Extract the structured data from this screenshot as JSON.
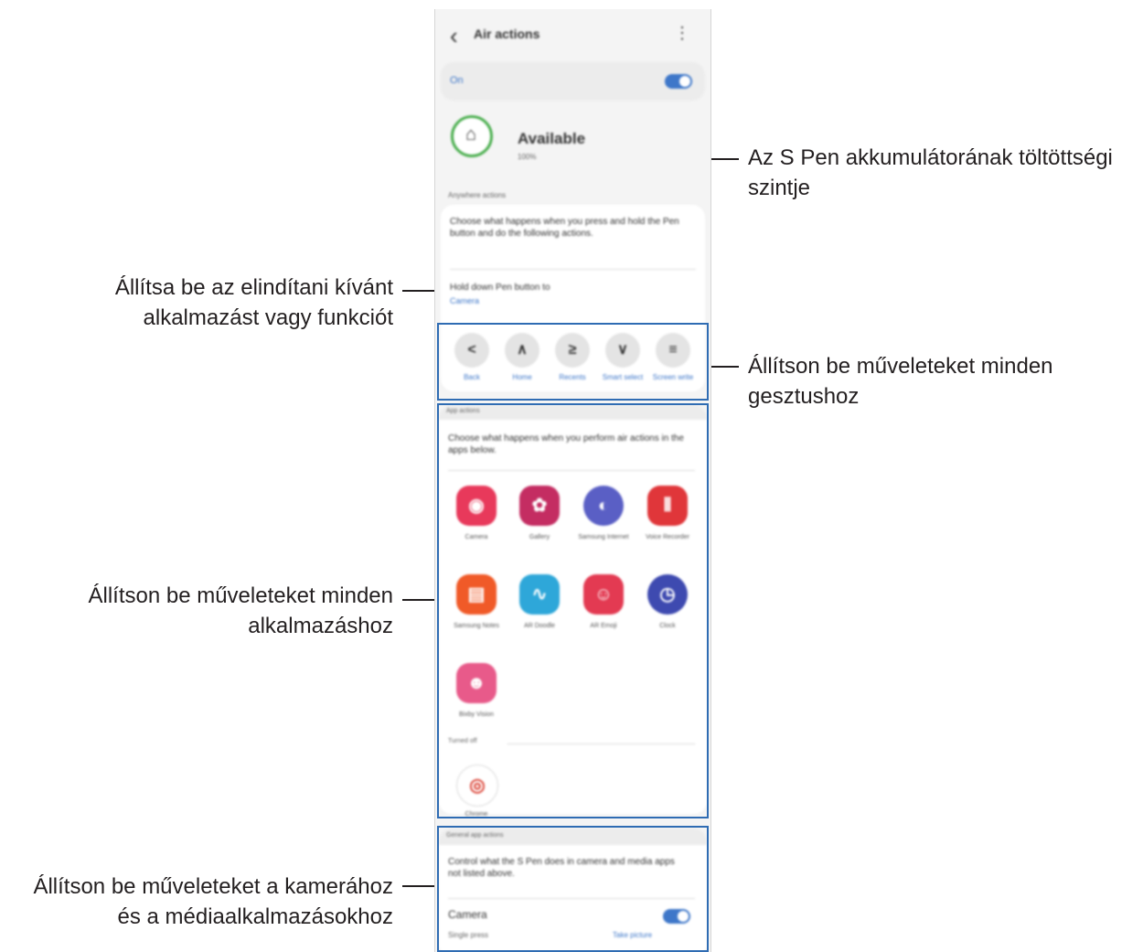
{
  "callouts": {
    "battery": "Az S Pen akkumulátorának töltöttségi szintje",
    "launch_app": "Állítsa be az elindítani kívánt alkalmazást vagy funkciót",
    "gestures": "Állítson be műveleteket minden gesztushoz",
    "apps": "Állítson be műveleteket minden alkalmazáshoz",
    "camera_media": "Állítson be műveleteket a kamerához és a médiaalkalmazásokhoz"
  },
  "phone": {
    "title": "Air actions",
    "master_toggle": {
      "label": "On",
      "state": "on"
    },
    "status": {
      "label": "Available",
      "battery_text": "100%"
    },
    "anywhere": {
      "header": "Anywhere actions",
      "description": "Choose what happens when you press and hold the Pen button and do the following actions.",
      "hold_label": "Hold down Pen button to",
      "hold_value": "Camera",
      "gestures": [
        {
          "glyph": "<",
          "label": "Back"
        },
        {
          "glyph": "∧",
          "label": "Home"
        },
        {
          "glyph": "≥",
          "label": "Recents"
        },
        {
          "glyph": "∨",
          "label": "Smart select"
        },
        {
          "glyph": "≡",
          "label": "Screen write"
        }
      ]
    },
    "app_actions": {
      "header": "App actions",
      "description": "Choose what happens when you perform air actions in the apps below.",
      "apps": [
        {
          "name": "Camera",
          "color": "#e8395b",
          "glyph": "◉"
        },
        {
          "name": "Gallery",
          "color": "#c42d62",
          "glyph": "✿"
        },
        {
          "name": "Samsung Internet",
          "color": "#5a5fc5",
          "glyph": "◐"
        },
        {
          "name": "Voice Recorder",
          "color": "#e0363a",
          "glyph": "⦀"
        },
        {
          "name": "Samsung Notes",
          "color": "#f05a28",
          "glyph": "▤"
        },
        {
          "name": "AR Doodle",
          "color": "#2ea7d9",
          "glyph": "∿"
        },
        {
          "name": "AR Emoji",
          "color": "#e33a52",
          "glyph": "☺"
        },
        {
          "name": "Clock",
          "color": "#3e4ab0",
          "glyph": "◷"
        },
        {
          "name": "Bixby Vision",
          "color": "#e85a8a",
          "glyph": "☻"
        }
      ],
      "turned_off_label": "Turned off",
      "turned_off_apps": [
        {
          "name": "Chrome",
          "color": "#ffffff",
          "glyph": "◎"
        }
      ]
    },
    "general": {
      "header": "General app actions",
      "description": "Control what the S Pen does in camera and media apps not listed above.",
      "camera_label": "Camera",
      "camera_state": "on",
      "single_press_label": "Single press",
      "single_press_value": "Take picture"
    }
  }
}
